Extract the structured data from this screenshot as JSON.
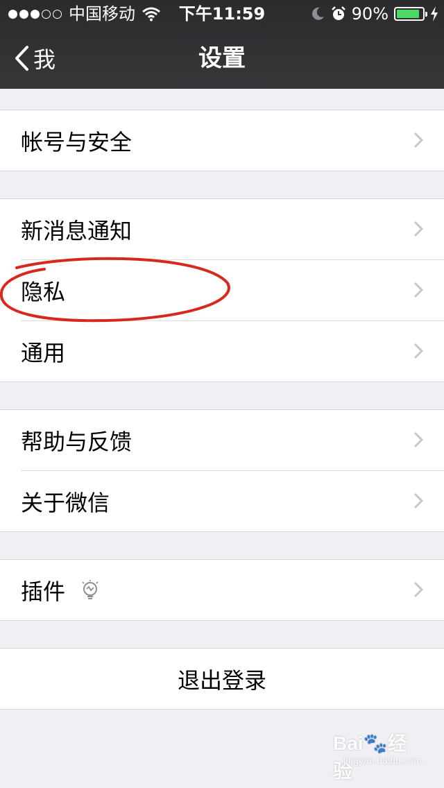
{
  "status_bar": {
    "carrier": "中国移动",
    "time": "下午11:59",
    "battery_percent_text": "90%",
    "battery_level": 0.9,
    "signal_bars": 3,
    "signal_total": 5
  },
  "nav": {
    "back_label": "我",
    "title": "设置"
  },
  "groups": [
    {
      "items": [
        {
          "label": "帐号与安全"
        }
      ]
    },
    {
      "items": [
        {
          "label": "新消息通知"
        },
        {
          "label": "隐私"
        },
        {
          "label": "通用"
        }
      ]
    },
    {
      "items": [
        {
          "label": "帮助与反馈"
        },
        {
          "label": "关于微信"
        }
      ]
    },
    {
      "items": [
        {
          "label": "插件",
          "icon": "lightbulb-icon"
        }
      ]
    }
  ],
  "logout": {
    "label": "退出登录"
  },
  "colors": {
    "nav_bg": "#2b2b2e",
    "page_bg": "#efeff4",
    "battery": "#4cd964",
    "annotation": "#d8281d",
    "chevron": "#c7c7cc"
  },
  "watermark": {
    "brand": "Bai",
    "brand_suffix": "经验",
    "site": "jingyan.baidu.com"
  }
}
